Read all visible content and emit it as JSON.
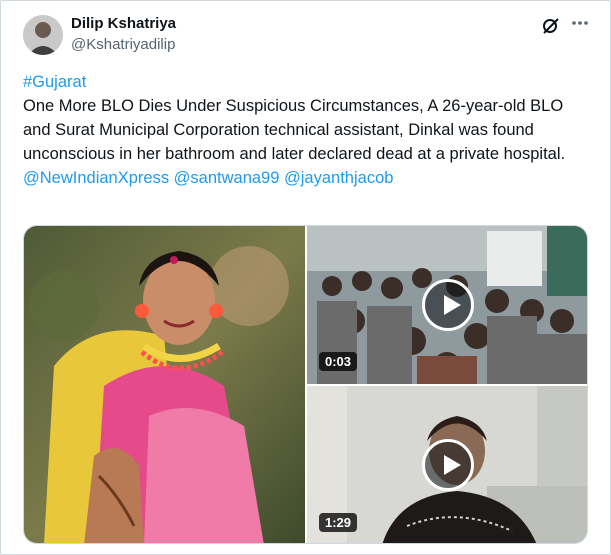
{
  "author": {
    "name": "Dilip Kshatriya",
    "handle": "@Kshatriyadilip"
  },
  "icons": {
    "avatar": "avatar-photo",
    "grok": "grok-icon",
    "more": "more-icon"
  },
  "tweet": {
    "hashtag": "#Gujarat",
    "text": "One More BLO Dies Under Suspicious Circumstances, A 26-year-old BLO and Surat Municipal Corporation technical assistant, Dinkal was found unconscious in her bathroom and later declared dead at a private hospital.",
    "mentions": [
      "@NewIndianXpress",
      "@santwana99",
      "@jayanthjacob"
    ]
  },
  "media": {
    "video1_duration": "0:03",
    "video2_duration": "1:29"
  },
  "colors": {
    "link": "#1d9bf0",
    "text": "#0f1419",
    "secondary": "#536471"
  }
}
